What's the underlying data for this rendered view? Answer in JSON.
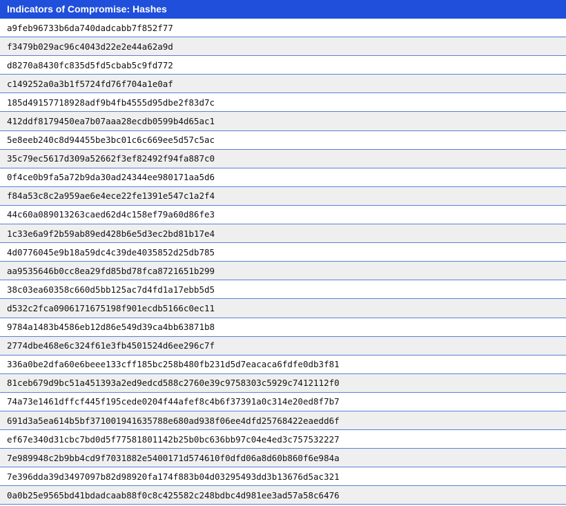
{
  "header": {
    "title": "Indicators of Compromise: Hashes"
  },
  "colors": {
    "header_background": "#1f4fdb",
    "header_text": "#ffffff",
    "row_divider": "#5b7fd6",
    "row_alt_background": "#efefef"
  },
  "hashes": [
    "a9feb96733b6da740dadcabb7f852f77",
    "f3479b029ac96c4043d22e2e44a62a9d",
    "d8270a8430fc835d5fd5cbab5c9fd772",
    "c149252a0a3b1f5724fd76f704a1e0af",
    "185d49157718928adf9b4fb4555d95dbe2f83d7c",
    "412ddf8179450ea7b07aaa28ecdb0599b4d65ac1",
    "5e8eeb240c8d94455be3bc01c6c669ee5d57c5ac",
    "35c79ec5617d309a52662f3ef82492f94fa887c0",
    "0f4ce0b9fa5a72b9da30ad24344ee980171aa5d6",
    "f84a53c8c2a959ae6e4ece22fe1391e547c1a2f4",
    "44c60a089013263caed62d4c158ef79a60d86fe3",
    "1c33e6a9f2b59ab89ed428b6e5d3ec2bd81b17e4",
    "4d0776045e9b18a59dc4c39de4035852d25db785",
    "aa9535646b0cc8ea29fd85bd78fca8721651b299",
    "38c03ea60358c660d5bb125ac7d4fd1a17ebb5d5",
    "d532c2fca0906171675198f901ecdb5166c0ec11",
    "9784a1483b4586eb12d86e549d39ca4bb63871b8",
    "2774dbe468e6c324f61e3fb4501524d6ee296c7f",
    "336a0be2dfa60e6beee133cff185bc258b480fb231d5d7eacaca6fdfe0db3f81",
    "81ceb679d9bc51a451393a2ed9edcd588c2760e39c9758303c5929c7412112f0",
    "74a73e1461dffcf445f195cede0204f44afef8c4b6f37391a0c314e20ed8f7b7",
    "691d3a5ea614b5bf371001941635788e680ad938f06ee4dfd25768422eaedd6f",
    "ef67e340d31cbc7bd0d5f77581801142b25b0bc636bb97c04e4ed3c757532227",
    "7e989948c2b9bb4cd9f7031882e5400171d574610f0dfd06a8d60b860f6e984a",
    "7e396dda39d3497097b82d98920fa174f883b04d03295493dd3b13676d5ac321",
    "0a0b25e9565bd41bdadcaab88f0c8c425582c248bdbc4d981ee3ad57a58c6476"
  ]
}
